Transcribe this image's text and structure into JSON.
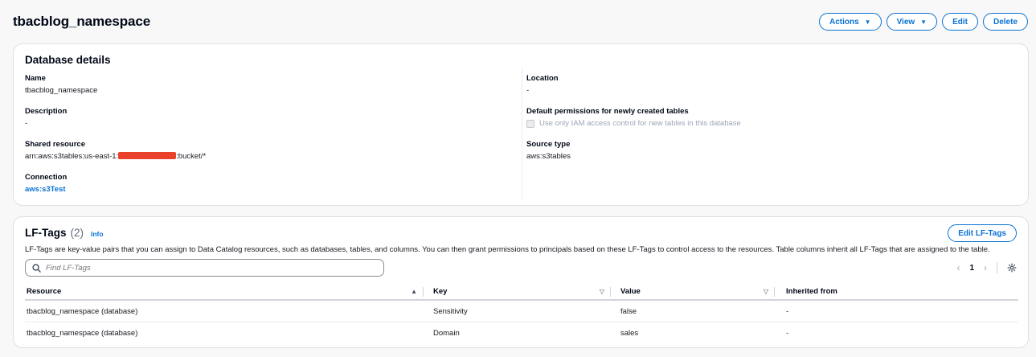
{
  "header": {
    "title": "tbacblog_namespace",
    "actions_label": "Actions",
    "view_label": "View",
    "edit_label": "Edit",
    "delete_label": "Delete"
  },
  "database_details": {
    "title": "Database details",
    "name_label": "Name",
    "name_value": "tbacblog_namespace",
    "description_label": "Description",
    "description_value": "-",
    "shared_resource_label": "Shared resource",
    "shared_resource_prefix": "arn:aws:s3tables:us-east-1:",
    "shared_resource_suffix": ":bucket/*",
    "connection_label": "Connection",
    "connection_value": "aws:s3Test",
    "location_label": "Location",
    "location_value": "-",
    "default_permissions_label": "Default permissions for newly created tables",
    "default_permissions_checkbox": "Use only IAM access control for new tables in this database",
    "source_type_label": "Source type",
    "source_type_value": "aws:s3tables"
  },
  "lf_tags": {
    "title": "LF-Tags",
    "count": "(2)",
    "info_label": "Info",
    "edit_button": "Edit LF-Tags",
    "description": "LF-Tags are key-value pairs that you can assign to Data Catalog resources, such as databases, tables, and columns. You can then grant permissions to principals based on these LF-Tags to control access to the resources. Table columns inherit all LF-Tags that are assigned to the table.",
    "search_placeholder": "Find LF-Tags",
    "page_number": "1",
    "columns": [
      "Resource",
      "Key",
      "Value",
      "Inherited from"
    ],
    "rows": [
      {
        "resource": "tbacblog_namespace (database)",
        "key": "Sensitivity",
        "value": "false",
        "inherited": "-"
      },
      {
        "resource": "tbacblog_namespace (database)",
        "key": "Domain",
        "value": "sales",
        "inherited": "-"
      }
    ]
  },
  "colors": {
    "primary": "#0972d3",
    "redaction": "#e8402b"
  }
}
